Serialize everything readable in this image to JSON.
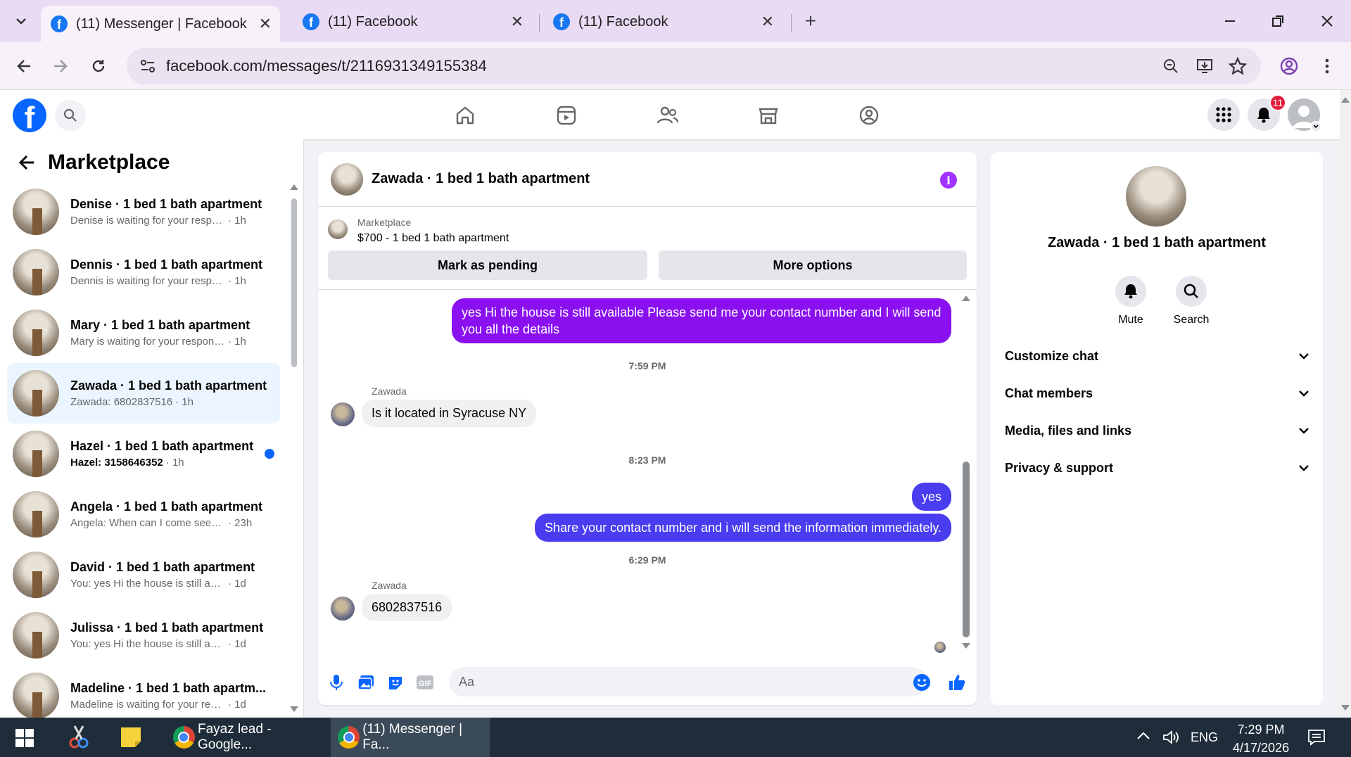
{
  "browser": {
    "tabs": [
      {
        "title": "(11) Messenger | Facebook",
        "active": true
      },
      {
        "title": "(11) Facebook",
        "active": false
      },
      {
        "title": "(11) Facebook",
        "active": false
      }
    ],
    "url": "facebook.com/messages/t/2116931349155384"
  },
  "header": {
    "notification_count": "11"
  },
  "left": {
    "title": "Marketplace",
    "chats": [
      {
        "name": "Denise · 1 bed 1 bath apartment",
        "preview": "Denise is waiting for your response.",
        "time": "· 1h",
        "unread": false,
        "selected": false
      },
      {
        "name": "Dennis · 1 bed 1 bath apartment",
        "preview": "Dennis is waiting for your respon...",
        "time": "· 1h",
        "unread": false,
        "selected": false
      },
      {
        "name": "Mary · 1 bed 1 bath apartment",
        "preview": "Mary is waiting for your response.",
        "time": "· 1h",
        "unread": false,
        "selected": false
      },
      {
        "name": "Zawada · 1 bed 1 bath apartment",
        "preview": "Zawada: 6802837516",
        "time": "· 1h",
        "unread": false,
        "selected": true
      },
      {
        "name": "Hazel · 1 bed 1 bath apartment",
        "preview": "Hazel: 3158646352",
        "time": "· 1h",
        "unread": true,
        "selected": false
      },
      {
        "name": "Angela · 1 bed 1 bath apartment",
        "preview": "Angela: When can I come seee it",
        "time": "· 23h",
        "unread": false,
        "selected": false
      },
      {
        "name": "David · 1 bed 1 bath apartment",
        "preview": "You: yes Hi the house is still availa...",
        "time": "· 1d",
        "unread": false,
        "selected": false
      },
      {
        "name": "Julissa · 1 bed 1 bath apartment",
        "preview": "You: yes Hi the house is still availa...",
        "time": "· 1d",
        "unread": false,
        "selected": false
      },
      {
        "name": "Madeline · 1 bed 1 bath apartm...",
        "preview": "Madeline is waiting for your respo...",
        "time": "· 1d",
        "unread": false,
        "selected": false
      }
    ]
  },
  "conversation": {
    "title": "Zawada · 1 bed 1 bath apartment",
    "marketplace_label": "Marketplace",
    "listing": "$700 - 1 bed 1 bath apartment",
    "mark_pending": "Mark as pending",
    "more_options": "More options",
    "messages": {
      "m1": "yes Hi the house is still available Please send me your contact number and I will send you all the details",
      "t1": "7:59 PM",
      "sender1": "Zawada",
      "m2": "Is it located in Syracuse NY",
      "t2": "8:23 PM",
      "m3": "yes",
      "m4": "Share your contact number and i will send the information immediately.",
      "t3": "6:29 PM",
      "sender2": "Zawada",
      "m5": "6802837516"
    },
    "input_placeholder": "Aa"
  },
  "right": {
    "name": "Zawada · 1 bed 1 bath apartment",
    "mute": "Mute",
    "search": "Search",
    "sections": [
      "Customize chat",
      "Chat members",
      "Media, files and links",
      "Privacy & support"
    ]
  },
  "taskbar": {
    "apps": [
      "Fayaz lead - Google...",
      "(11) Messenger | Fa..."
    ],
    "lang": "ENG",
    "time": "7:29 PM",
    "date": "4/17/2026"
  },
  "colors": {
    "accent": "#0866ff",
    "bubble_purple": "#8a10f0",
    "bubble_blue": "#4a3df0",
    "info": "#a033ff"
  }
}
